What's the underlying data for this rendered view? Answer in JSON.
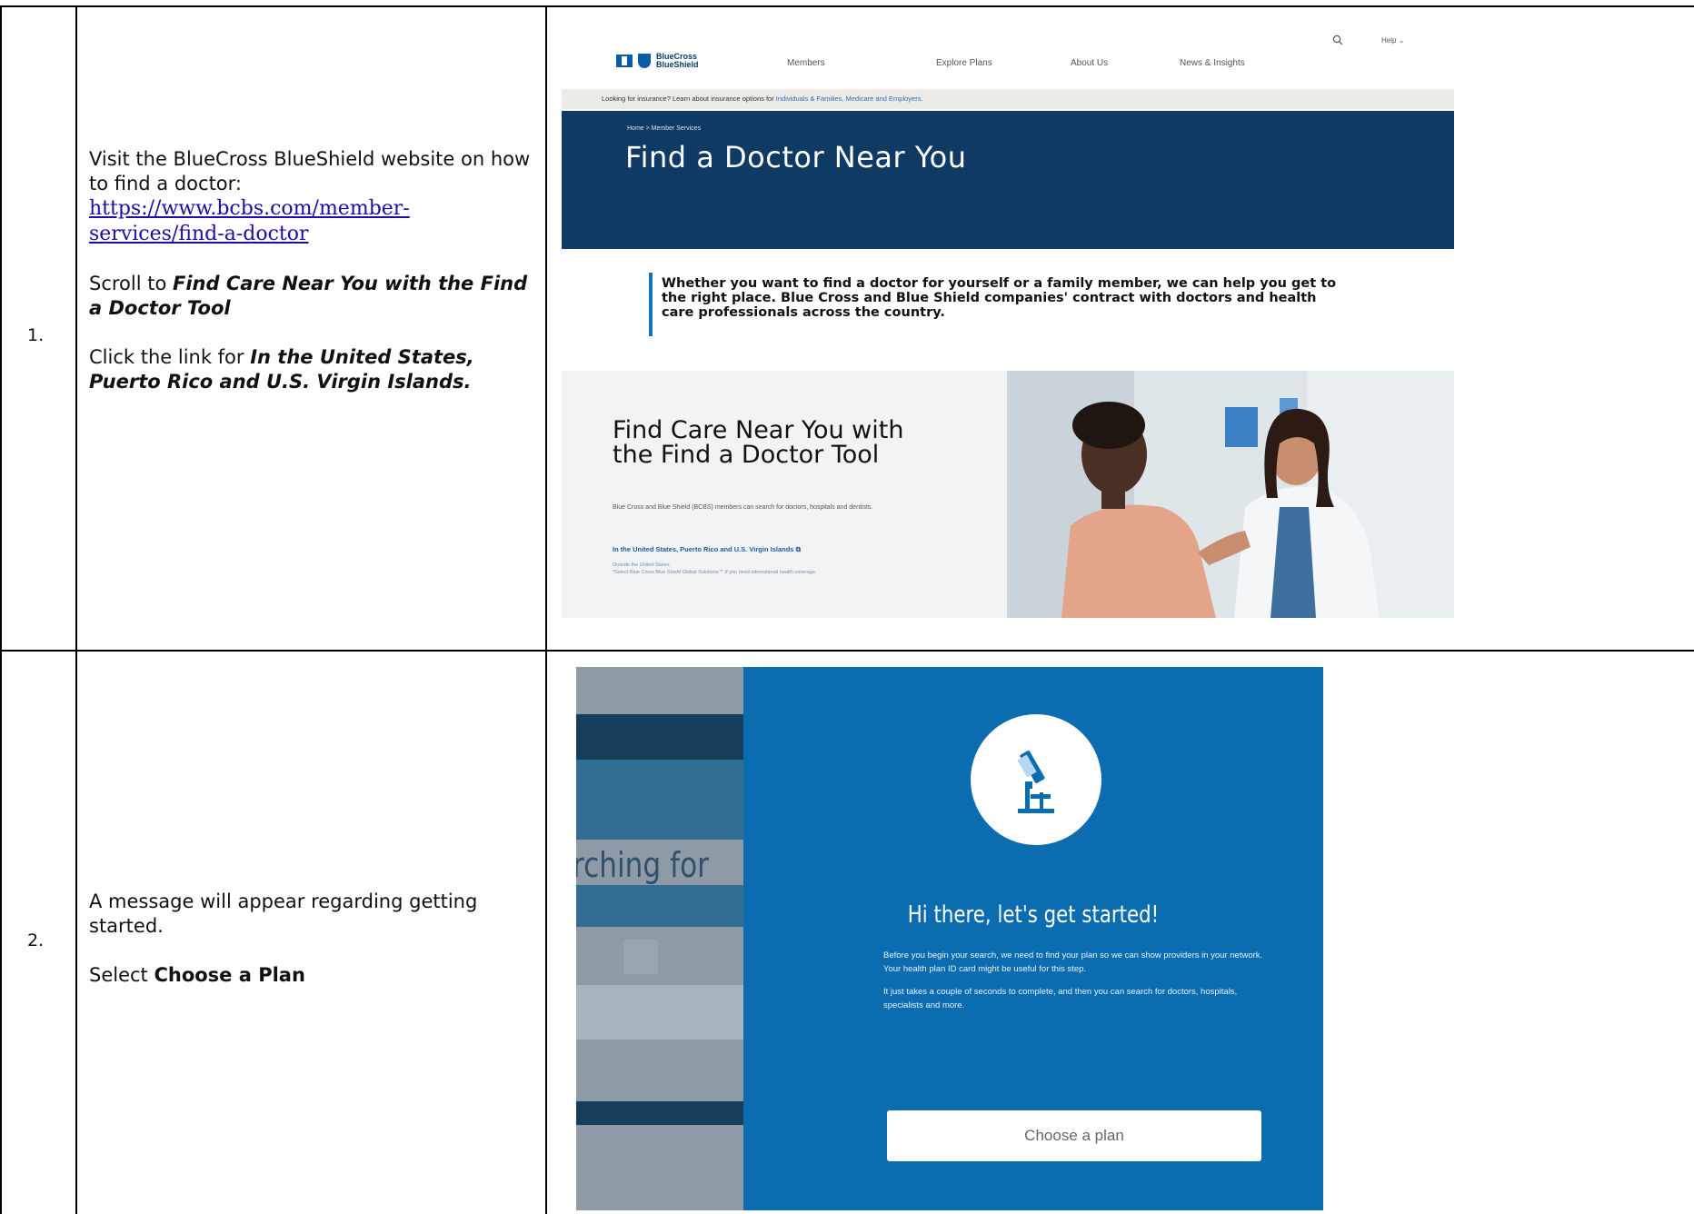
{
  "rows": [
    {
      "number": "1.",
      "intro_text": "Visit the BlueCross BlueShield website on how to find a doctor:",
      "link": "https://www.bcbs.com/member-services/find-a-doctor",
      "link_line1": "https://www.bcbs.com/member-",
      "link_line2": "services/find-a-doctor",
      "scroll_prefix": "Scroll to ",
      "scroll_target": "Find Care Near You with the Find a Doctor Tool",
      "click_prefix": "Click the link for ",
      "click_target": "In the United States, Puerto Rico and U.S. Virgin Islands."
    },
    {
      "number": "2.",
      "message_text": "A message will appear regarding getting started.",
      "select_prefix": "Select ",
      "select_target": "Choose a Plan"
    }
  ],
  "screenshot1": {
    "logo_line1": "BlueCross",
    "logo_line2": "BlueShield",
    "nav": [
      "Members",
      "Explore Plans",
      "About Us",
      "News & Insights"
    ],
    "help": "Help",
    "banner_text": "Looking for insurance? Learn about insurance options for ",
    "banner_links": "Individuals & Families, Medicare and Employers.",
    "breadcrumb": "Home  >  Member Services",
    "hero_title": "Find a Doctor Near You",
    "intro": "Whether you want to find a doctor for yourself or a family member, we can help you get to the right place. Blue Cross and Blue Shield companies' contract with doctors and health care professionals across the country.",
    "card_title": "Find Care Near You with the Find a Doctor Tool",
    "card_desc": "Blue Cross and Blue Shield (BCBS) members can search for doctors, hospitals and dentists.",
    "card_link": "In the United States, Puerto Rico and U.S. Virgin Islands",
    "card_sub1": "Outside the United States",
    "card_sub2": "*Select Blue Cross Blue Shield Global Solutions℠ if you need international health coverage."
  },
  "screenshot2": {
    "partial_text": "rching for",
    "heading": "Hi there, let's get started!",
    "paragraph1": "Before you begin your search, we need to find your plan so we can show providers in your network. Your health plan ID card might be useful for this step.",
    "paragraph2": "It just takes a couple of seconds to complete, and then you can search for doctors, hospitals, specialists and more.",
    "button": "Choose a plan"
  }
}
